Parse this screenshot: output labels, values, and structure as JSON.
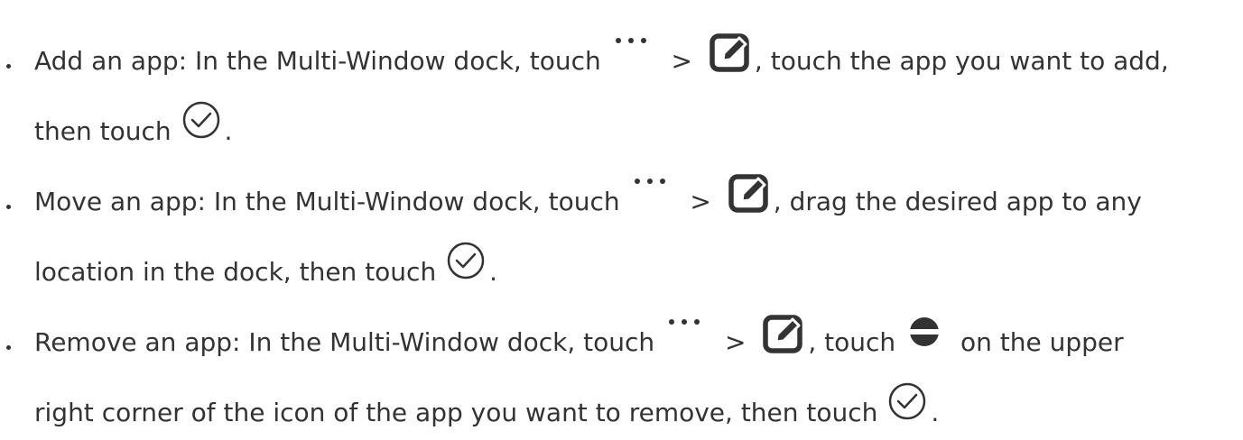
{
  "colors": {
    "text": "#333333",
    "icon": "#333333",
    "icon_bg": "#ffffff"
  },
  "icons": {
    "more": "more-dots-icon",
    "edit": "edit-icon",
    "confirm": "check-circle-icon",
    "remove": "remove-circle-icon"
  },
  "items": [
    {
      "l1_a": "Add an app: In the Multi-Window dock, touch",
      "gt": ">",
      "l1_b": ", touch the app you want to add,",
      "l2_a": "then touch",
      "l2_end": "."
    },
    {
      "l1_a": "Move an app: In the Multi-Window dock, touch",
      "gt": ">",
      "l1_b": ", drag the desired app to any",
      "l2_a": "location in the dock, then touch",
      "l2_end": "."
    },
    {
      "l1_a": "Remove an app: In the Multi-Window dock, touch",
      "gt": ">",
      "l1_b": ", touch",
      "l1_c": "on the upper",
      "l2_a": "right corner of the icon of the app you want to remove, then touch",
      "l2_end": "."
    }
  ]
}
